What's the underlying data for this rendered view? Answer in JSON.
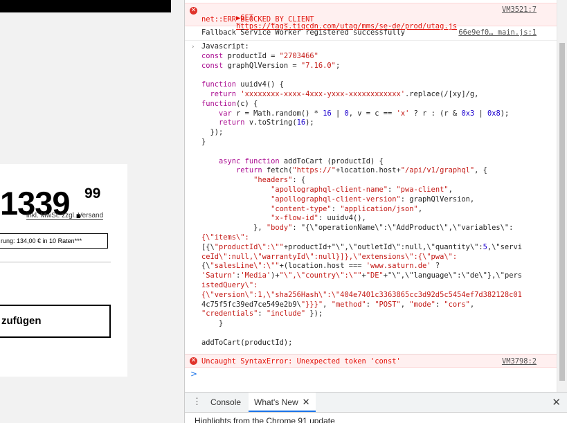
{
  "left_page": {
    "price_main": "1339",
    "price_cents": "99",
    "price_dot": ".",
    "vat_note": "inkl. MwSt. zzgl. Versand",
    "financing": "rung: 134,00 € in 10 Raten***",
    "add_to_cart": "zufügen"
  },
  "console": {
    "error1": {
      "method": "▶GET",
      "url": "https://tags.tiqcdn.com/utag/mms/se-de/prod/utag.js",
      "detail": "net::ERR_BLOCKED_BY_CLIENT",
      "source": "VM3521:7"
    },
    "log1": {
      "text": "Fallback Service Worker registered successfully",
      "source": "66e9ef0… main.js:1"
    },
    "code_arrow": "›",
    "code": [
      "Javascript:",
      "const productId = \"2703466\"",
      "const graphQlVersion = \"7.16.0\";",
      "",
      "function uuidv4() {",
      "  return 'xxxxxxxx-xxxx-4xxx-yxxx-xxxxxxxxxxxx'.replace(/[xy]/g,",
      "function(c) {",
      "    var r = Math.random() * 16 | 0, v = c == 'x' ? r : (r & 0x3 | 0x8);",
      "    return v.toString(16);",
      "  });",
      "}",
      "",
      "    async function addToCart (productId) {",
      "        return fetch(\"https://\"+location.host+\"/api/v1/graphql\", {",
      "            \"headers\": {",
      "                \"apollographql-client-name\": \"pwa-client\",",
      "                \"apollographql-client-version\": graphQlVersion,",
      "                \"content-type\": \"application/json\",",
      "                \"x-flow-id\": uuidv4(),",
      "            }, \"body\": \"{\\\"operationName\\\":\\\"AddProduct\\\",\\\"variables\\\":",
      "{\\\"items\\\":",
      "[{\\\"productId\\\":\\\"\"+productId+\"\\\",\\\"outletId\\\":null,\\\"quantity\\\":5,\\\"servi",
      "ceId\\\":null,\\\"warrantyId\\\":null}]},\\\"extensions\\\":{\\\"pwa\\\":",
      "{\\\"salesLine\\\":\\\"\"+(location.host === 'www.saturn.de' ?",
      "'Saturn':'Media')+\"\\\",\\\"country\\\":\\\"\"+\"DE\"+\"\\\",\\\"language\\\":\\\"de\\\"},\\\"pers",
      "istedQuery\\\":",
      "{\\\"version\\\":1,\\\"sha256Hash\\\":\\\"404e7401c3363865cc3d92d5c5454ef7d382128c01",
      "4c75f5fc39ed7ce549e2b9\\\"}}}\", \"method\": \"POST\", \"mode\": \"cors\",",
      "\"credentials\": \"include\" });",
      "    }",
      "",
      "addToCart(productId);"
    ],
    "error2": {
      "text": "Uncaught SyntaxError: Unexpected token 'const'",
      "source": "VM3798:2"
    },
    "prompt": ">"
  },
  "drawer": {
    "menu_icon": "⋮",
    "tabs": [
      {
        "label": "Console"
      },
      {
        "label": "What's New",
        "close": "✕"
      }
    ],
    "close": "✕",
    "content": "Highlights from the Chrome 91 update"
  },
  "colors": {
    "error_bg": "#fff0f0",
    "error_text": "#e2120a",
    "accent": "#1a73e8"
  }
}
